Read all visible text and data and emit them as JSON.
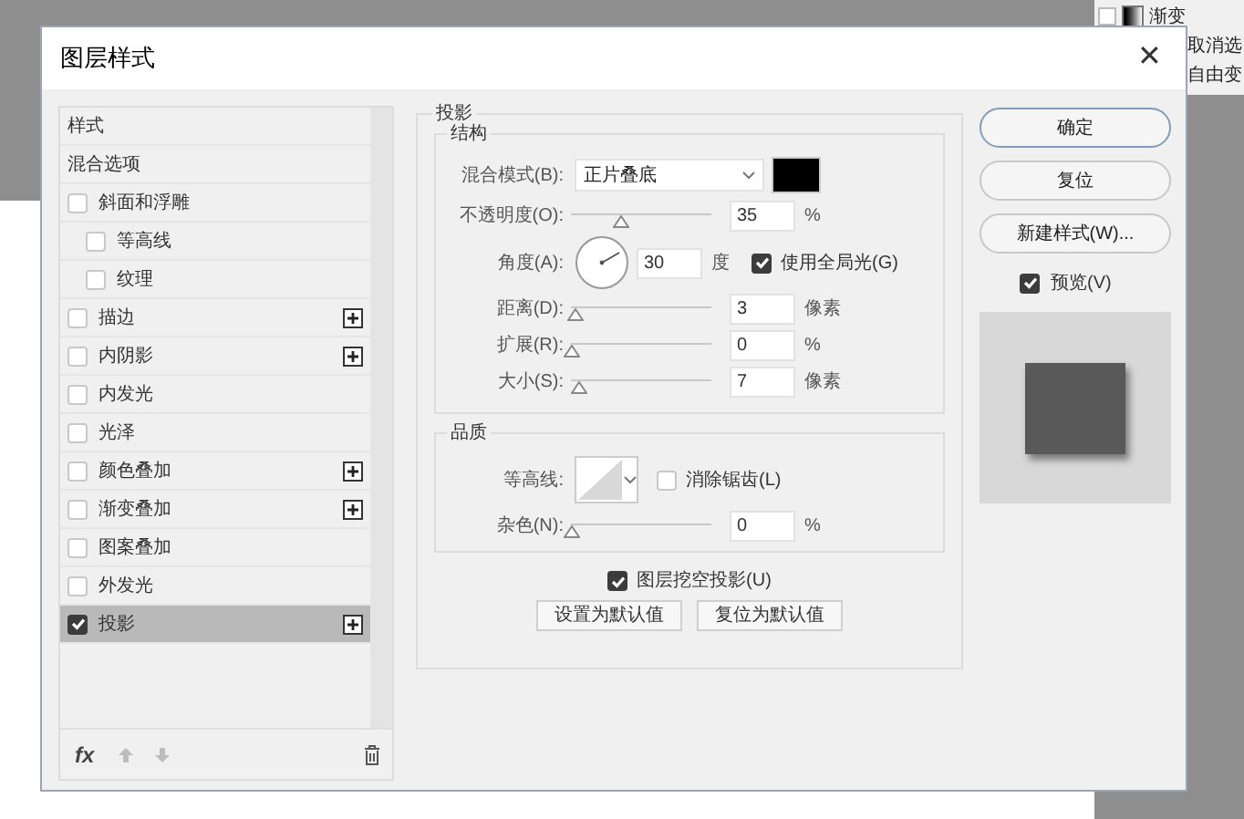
{
  "background_panel": {
    "items": [
      {
        "label": "渐变",
        "kind": "gradient",
        "checked": false
      },
      {
        "label": "取消选",
        "kind": "plain"
      },
      {
        "label": "自由变",
        "kind": "plain"
      }
    ]
  },
  "window": {
    "title": "图层样式",
    "close": "✕"
  },
  "styles": [
    {
      "label": "样式",
      "kind": "header",
      "selected": false
    },
    {
      "label": "混合选项",
      "kind": "header",
      "selected": false
    },
    {
      "label": "斜面和浮雕",
      "kind": "effect",
      "checked": false,
      "selected": false,
      "add_button": false,
      "children": [
        {
          "label": "等高线",
          "kind": "effect",
          "checked": false,
          "selected": false,
          "add_button": false
        },
        {
          "label": "纹理",
          "kind": "effect",
          "checked": false,
          "selected": false,
          "add_button": false
        }
      ]
    },
    {
      "label": "描边",
      "kind": "effect",
      "checked": false,
      "selected": false,
      "add_button": true
    },
    {
      "label": "内阴影",
      "kind": "effect",
      "checked": false,
      "selected": false,
      "add_button": true
    },
    {
      "label": "内发光",
      "kind": "effect",
      "checked": false,
      "selected": false,
      "add_button": false
    },
    {
      "label": "光泽",
      "kind": "effect",
      "checked": false,
      "selected": false,
      "add_button": false
    },
    {
      "label": "颜色叠加",
      "kind": "effect",
      "checked": false,
      "selected": false,
      "add_button": true
    },
    {
      "label": "渐变叠加",
      "kind": "effect",
      "checked": false,
      "selected": false,
      "add_button": true
    },
    {
      "label": "图案叠加",
      "kind": "effect",
      "checked": false,
      "selected": false,
      "add_button": false
    },
    {
      "label": "外发光",
      "kind": "effect",
      "checked": false,
      "selected": false,
      "add_button": false
    },
    {
      "label": "投影",
      "kind": "effect",
      "checked": true,
      "selected": true,
      "add_button": true
    }
  ],
  "list_toolbar": {
    "fx": "fx"
  },
  "drop_shadow": {
    "title": "投影",
    "structure": {
      "title": "结构",
      "rows": [
        {
          "kind": "dropdown",
          "label": "混合模式(B):",
          "value": "正片叠底",
          "color": "#000000"
        },
        {
          "kind": "slider",
          "label": "不透明度(O):",
          "level": 0.35,
          "value": "35",
          "unit": "%"
        },
        {
          "kind": "angle",
          "label": "角度(A):",
          "value": "30",
          "unit": "度",
          "option": {
            "label": "使用全局光(G)",
            "checked": true
          }
        },
        {
          "kind": "slider",
          "label": "距离(D):",
          "level": 0.03,
          "value": "3",
          "unit": "像素"
        },
        {
          "kind": "slider",
          "label": "扩展(R):",
          "level": 0,
          "value": "0",
          "unit": "%"
        },
        {
          "kind": "slider",
          "label": "大小(S):",
          "level": 0.05,
          "value": "7",
          "unit": "像素"
        }
      ]
    },
    "quality": {
      "title": "品质",
      "rows": [
        {
          "kind": "contour",
          "label": "等高线:",
          "option": {
            "label": "消除锯齿(L)",
            "checked": false
          }
        },
        {
          "kind": "slider",
          "label": "杂色(N):",
          "level": 0,
          "value": "0",
          "unit": "%"
        }
      ]
    },
    "knockout": {
      "label": "图层挖空投影(U)",
      "checked": true
    },
    "buttons": [
      "设置为默认值",
      "复位为默认值"
    ]
  },
  "side_buttons": [
    {
      "label": "确定",
      "primary": true
    },
    {
      "label": "复位",
      "primary": false
    },
    {
      "label": "新建样式(W)...",
      "primary": false
    }
  ],
  "preview": {
    "label": "预览(V)",
    "checked": true
  }
}
